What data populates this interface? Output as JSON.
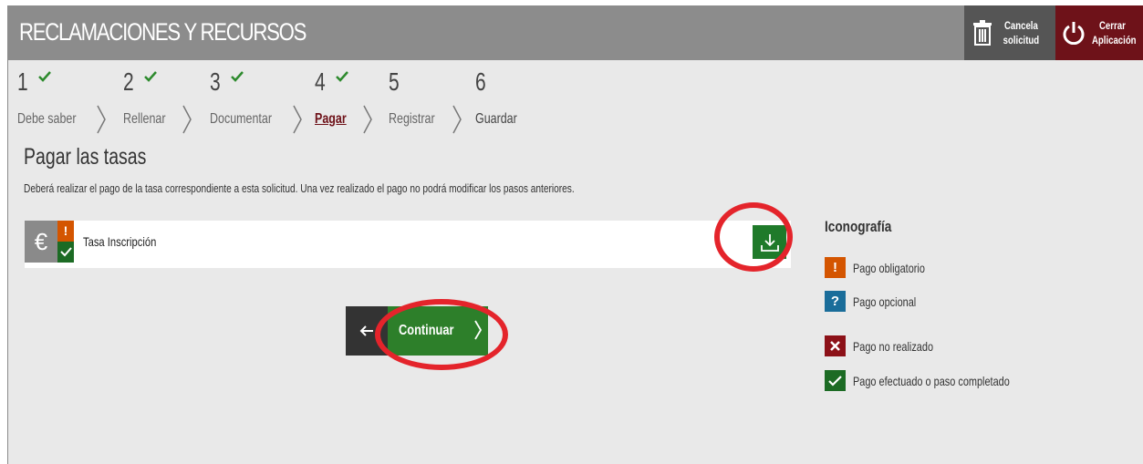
{
  "app": {
    "title": "RECLAMACIONES Y RECURSOS"
  },
  "toolbar": {
    "cancel_line1": "Cancela",
    "cancel_line2": "solicitud",
    "close_line1": "Cerrar",
    "close_line2": "Aplicación"
  },
  "steps": [
    {
      "number": "1",
      "label": "Debe saber",
      "done": true
    },
    {
      "number": "2",
      "label": "Rellenar",
      "done": true
    },
    {
      "number": "3",
      "label": "Documentar",
      "done": true
    },
    {
      "number": "4",
      "label": "Pagar",
      "done": true,
      "active": true
    },
    {
      "number": "5",
      "label": "Registrar",
      "done": false
    },
    {
      "number": "6",
      "label": "Guardar",
      "done": false
    }
  ],
  "page": {
    "title": "Pagar las tasas",
    "description": "Deberá realizar el pago de la tasa correspondiente a esta solicitud. Una vez realizado el pago no podrá modificar los pasos anteriores."
  },
  "fee": {
    "currency_symbol": "€",
    "mandatory_mark": "!",
    "name": "Tasa Inscripción"
  },
  "nav": {
    "continue_label": "Continuar"
  },
  "legend": {
    "title": "Iconografía",
    "items": [
      {
        "symbol": "!",
        "label": "Pago obligatorio",
        "color": "#d45500"
      },
      {
        "symbol": "?",
        "label": "Pago opcional",
        "color": "#1a6d9a"
      },
      {
        "symbol": "x",
        "label": "Pago no realizado",
        "color": "#8c1118"
      },
      {
        "symbol": "check",
        "label": "Pago efectuado o paso completado",
        "color": "#1c6b24"
      }
    ]
  },
  "colors": {
    "brand_dark": "#6e1219",
    "success": "#1f7a2a",
    "highlight_circle": "#e4242b"
  }
}
